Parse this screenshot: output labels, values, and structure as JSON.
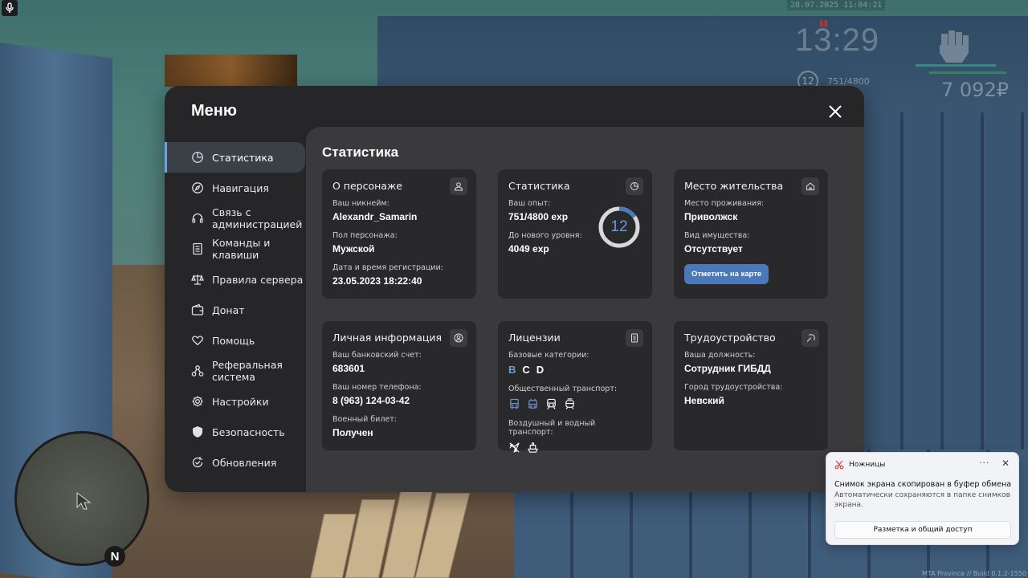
{
  "hud": {
    "date": "28.07.2025 11:04:21",
    "time": "13:29",
    "level": "12",
    "exp": "751/4800",
    "money": "7 092₽",
    "minimap_north": "N",
    "watermark": "MTA Province // Build 0.1.2-1550"
  },
  "menu": {
    "title": "Меню",
    "sidebar": [
      {
        "label": "Статистика",
        "icon": "pie-chart-icon",
        "active": true
      },
      {
        "label": "Навигация",
        "icon": "compass-icon"
      },
      {
        "label": "Связь с администрацией",
        "icon": "headset-icon"
      },
      {
        "label": "Команды и клавиши",
        "icon": "document-list-icon"
      },
      {
        "label": "Правила сервера",
        "icon": "scales-icon"
      },
      {
        "label": "Донат",
        "icon": "wallet-icon"
      },
      {
        "label": "Помощь",
        "icon": "heart-hand-icon"
      },
      {
        "label": "Реферальная система",
        "icon": "network-icon"
      },
      {
        "label": "Настройки",
        "icon": "gear-icon"
      },
      {
        "label": "Безопасность",
        "icon": "shield-icon"
      },
      {
        "label": "Обновления",
        "icon": "refresh-check-icon"
      }
    ],
    "content_title": "Статистика",
    "cards": {
      "character": {
        "title": "О персонаже",
        "icon": "user-icon",
        "nickname_label": "Ваш никнейм:",
        "nickname": "Alexandr_Samarin",
        "gender_label": "Пол персонажа:",
        "gender": "Мужской",
        "reg_label": "Дата и время регистрации:",
        "reg": "23.05.2023 18:22:40"
      },
      "stats": {
        "title": "Статистика",
        "icon": "pie-chart-icon",
        "exp_label": "Ваш опыт:",
        "exp": "751/4800 exp",
        "next_label": "До нового уровня:",
        "next": "4049 exp",
        "level": "12",
        "progress": 0.156
      },
      "residence": {
        "title": "Место жительства",
        "icon": "home-icon",
        "place_label": "Место проживания:",
        "place": "Приволжск",
        "property_label": "Вид имущества:",
        "property": "Отсутствует",
        "button": "Отметить на карте"
      },
      "personal": {
        "title": "Личная информация",
        "icon": "user-circle-icon",
        "bank_label": "Ваш банковский счет:",
        "bank": "683601",
        "phone_label": "Ваш номер телефона:",
        "phone": "8 (963) 124-03-42",
        "military_label": "Военный билет:",
        "military": "Получен"
      },
      "licenses": {
        "title": "Лицензии",
        "icon": "id-card-icon",
        "basic_label": "Базовые категории:",
        "basic": [
          "B",
          "C",
          "D"
        ],
        "public_label": "Общественный транспорт:",
        "air_label": "Воздушный и водный транспорт:"
      },
      "job": {
        "title": "Трудоустройство",
        "icon": "pickaxe-icon",
        "position_label": "Ваша должность:",
        "position": "Сотрудник ГИБДД",
        "city_label": "Город трудоустройства:",
        "city": "Невский"
      }
    }
  },
  "toast": {
    "app": "Ножницы",
    "more": "···",
    "close": "✕",
    "main": "Снимок экрана скопирован в буфер обмена",
    "sub": "Автоматически сохраняются в папке снимков экрана.",
    "button": "Разметка и общий доступ"
  },
  "colors": {
    "accent": "#6ea2e6",
    "button": "#4a78b8",
    "panel": "#262628",
    "content": "#3a3a3c",
    "card": "#29292b"
  }
}
